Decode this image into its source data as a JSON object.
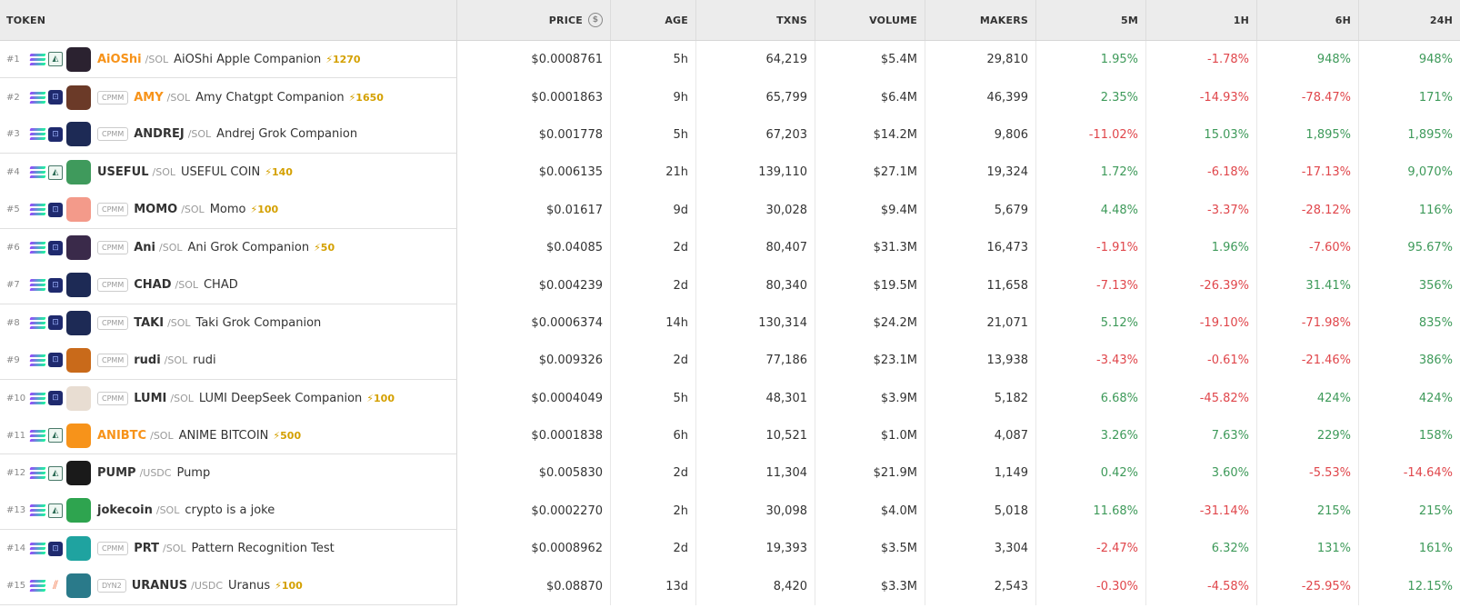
{
  "columns": {
    "token": "TOKEN",
    "price": "PRICE",
    "age": "AGE",
    "txns": "TXNS",
    "volume": "VOLUME",
    "makers": "MAKERS",
    "m5": "5M",
    "h1": "1H",
    "h6": "6H",
    "h24": "24H"
  },
  "colors": {
    "positive": "#3e9a5a",
    "negative": "#e0464b",
    "boost": "#d4a000"
  },
  "rows": [
    {
      "rank": "#1",
      "dex": "raydium",
      "tag": "",
      "symbol": "AiOShi",
      "symbol_color": "orange",
      "quote": "/SOL",
      "name": "AiOShi Apple Companion",
      "boost": "⚡1270",
      "price": "$0.0008761",
      "age": "5h",
      "txns": "64,219",
      "volume": "$5.4M",
      "makers": "29,810",
      "m5": "1.95%",
      "h1": "-1.78%",
      "h6": "948%",
      "h24": "948%",
      "avatar_color": "#2b2230"
    },
    {
      "rank": "#2",
      "dex": "cpmm",
      "tag": "CPMM",
      "symbol": "AMY",
      "symbol_color": "orange",
      "quote": "/SOL",
      "name": "Amy Chatgpt Companion",
      "boost": "⚡1650",
      "price": "$0.0001863",
      "age": "9h",
      "txns": "65,799",
      "volume": "$6.4M",
      "makers": "46,399",
      "m5": "2.35%",
      "h1": "-14.93%",
      "h6": "-78.47%",
      "h24": "171%",
      "avatar_color": "#6b3a28"
    },
    {
      "rank": "#3",
      "dex": "cpmm",
      "tag": "CPMM",
      "symbol": "ANDREJ",
      "symbol_color": "",
      "quote": "/SOL",
      "name": "Andrej Grok Companion",
      "boost": "",
      "price": "$0.001778",
      "age": "5h",
      "txns": "67,203",
      "volume": "$14.2M",
      "makers": "9,806",
      "m5": "-11.02%",
      "h1": "15.03%",
      "h6": "1,895%",
      "h24": "1,895%",
      "avatar_color": "#1d2a55"
    },
    {
      "rank": "#4",
      "dex": "raydium",
      "tag": "",
      "symbol": "USEFUL",
      "symbol_color": "",
      "quote": "/SOL",
      "name": "USEFUL COIN",
      "boost": "⚡140",
      "price": "$0.006135",
      "age": "21h",
      "txns": "139,110",
      "volume": "$27.1M",
      "makers": "19,324",
      "m5": "1.72%",
      "h1": "-6.18%",
      "h6": "-17.13%",
      "h24": "9,070%",
      "avatar_color": "#3f9a5c"
    },
    {
      "rank": "#5",
      "dex": "cpmm",
      "tag": "CPMM",
      "symbol": "MOMO",
      "symbol_color": "",
      "quote": "/SOL",
      "name": "Momo",
      "boost": "⚡100",
      "price": "$0.01617",
      "age": "9d",
      "txns": "30,028",
      "volume": "$9.4M",
      "makers": "5,679",
      "m5": "4.48%",
      "h1": "-3.37%",
      "h6": "-28.12%",
      "h24": "116%",
      "avatar_color": "#f39a8a"
    },
    {
      "rank": "#6",
      "dex": "cpmm",
      "tag": "CPMM",
      "symbol": "Ani",
      "symbol_color": "",
      "quote": "/SOL",
      "name": "Ani Grok Companion",
      "boost": "⚡50",
      "price": "$0.04085",
      "age": "2d",
      "txns": "80,407",
      "volume": "$31.3M",
      "makers": "16,473",
      "m5": "-1.91%",
      "h1": "1.96%",
      "h6": "-7.60%",
      "h24": "95.67%",
      "avatar_color": "#3a2a4a"
    },
    {
      "rank": "#7",
      "dex": "cpmm",
      "tag": "CPMM",
      "symbol": "CHAD",
      "symbol_color": "",
      "quote": "/SOL",
      "name": "CHAD",
      "boost": "",
      "price": "$0.004239",
      "age": "2d",
      "txns": "80,340",
      "volume": "$19.5M",
      "makers": "11,658",
      "m5": "-7.13%",
      "h1": "-26.39%",
      "h6": "31.41%",
      "h24": "356%",
      "avatar_color": "#1d2a55"
    },
    {
      "rank": "#8",
      "dex": "cpmm",
      "tag": "CPMM",
      "symbol": "TAKI",
      "symbol_color": "",
      "quote": "/SOL",
      "name": "Taki Grok Companion",
      "boost": "",
      "price": "$0.0006374",
      "age": "14h",
      "txns": "130,314",
      "volume": "$24.2M",
      "makers": "21,071",
      "m5": "5.12%",
      "h1": "-19.10%",
      "h6": "-71.98%",
      "h24": "835%",
      "avatar_color": "#1d2a55"
    },
    {
      "rank": "#9",
      "dex": "cpmm",
      "tag": "CPMM",
      "symbol": "rudi",
      "symbol_color": "",
      "quote": "/SOL",
      "name": "rudi",
      "boost": "",
      "price": "$0.009326",
      "age": "2d",
      "txns": "77,186",
      "volume": "$23.1M",
      "makers": "13,938",
      "m5": "-3.43%",
      "h1": "-0.61%",
      "h6": "-21.46%",
      "h24": "386%",
      "avatar_color": "#c96a1a"
    },
    {
      "rank": "#10",
      "dex": "cpmm",
      "tag": "CPMM",
      "symbol": "LUMI",
      "symbol_color": "",
      "quote": "/SOL",
      "name": "LUMI DeepSeek Companion",
      "boost": "⚡100",
      "price": "$0.0004049",
      "age": "5h",
      "txns": "48,301",
      "volume": "$3.9M",
      "makers": "5,182",
      "m5": "6.68%",
      "h1": "-45.82%",
      "h6": "424%",
      "h24": "424%",
      "avatar_color": "#e8ddd2"
    },
    {
      "rank": "#11",
      "dex": "raydium",
      "tag": "",
      "symbol": "ANIBTC",
      "symbol_color": "orange",
      "quote": "/SOL",
      "name": "ANIME BITCOIN",
      "boost": "⚡500",
      "price": "$0.0001838",
      "age": "6h",
      "txns": "10,521",
      "volume": "$1.0M",
      "makers": "4,087",
      "m5": "3.26%",
      "h1": "7.63%",
      "h6": "229%",
      "h24": "158%",
      "avatar_color": "#f7931a"
    },
    {
      "rank": "#12",
      "dex": "raydium",
      "tag": "",
      "symbol": "PUMP",
      "symbol_color": "",
      "quote": "/USDC",
      "name": "Pump",
      "boost": "",
      "price": "$0.005830",
      "age": "2d",
      "txns": "11,304",
      "volume": "$21.9M",
      "makers": "1,149",
      "m5": "0.42%",
      "h1": "3.60%",
      "h6": "-5.53%",
      "h24": "-14.64%",
      "avatar_color": "#1a1a1a"
    },
    {
      "rank": "#13",
      "dex": "raydium",
      "tag": "",
      "symbol": "jokecoin",
      "symbol_color": "",
      "quote": "/SOL",
      "name": "crypto is a joke",
      "boost": "",
      "price": "$0.0002270",
      "age": "2h",
      "txns": "30,098",
      "volume": "$4.0M",
      "makers": "5,018",
      "m5": "11.68%",
      "h1": "-31.14%",
      "h6": "215%",
      "h24": "215%",
      "avatar_color": "#2ea44f"
    },
    {
      "rank": "#14",
      "dex": "cpmm",
      "tag": "CPMM",
      "symbol": "PRT",
      "symbol_color": "",
      "quote": "/SOL",
      "name": "Pattern Recognition Test",
      "boost": "",
      "price": "$0.0008962",
      "age": "2d",
      "txns": "19,393",
      "volume": "$3.5M",
      "makers": "3,304",
      "m5": "-2.47%",
      "h1": "6.32%",
      "h6": "131%",
      "h24": "161%",
      "avatar_color": "#1fa3a0"
    },
    {
      "rank": "#15",
      "dex": "meteora",
      "tag": "DYN2",
      "symbol": "URANUS",
      "symbol_color": "",
      "quote": "/USDC",
      "name": "Uranus",
      "boost": "⚡100",
      "price": "$0.08870",
      "age": "13d",
      "txns": "8,420",
      "volume": "$3.3M",
      "makers": "2,543",
      "m5": "-0.30%",
      "h1": "-4.58%",
      "h6": "-25.95%",
      "h24": "12.15%",
      "avatar_color": "#2a7a8a"
    }
  ]
}
